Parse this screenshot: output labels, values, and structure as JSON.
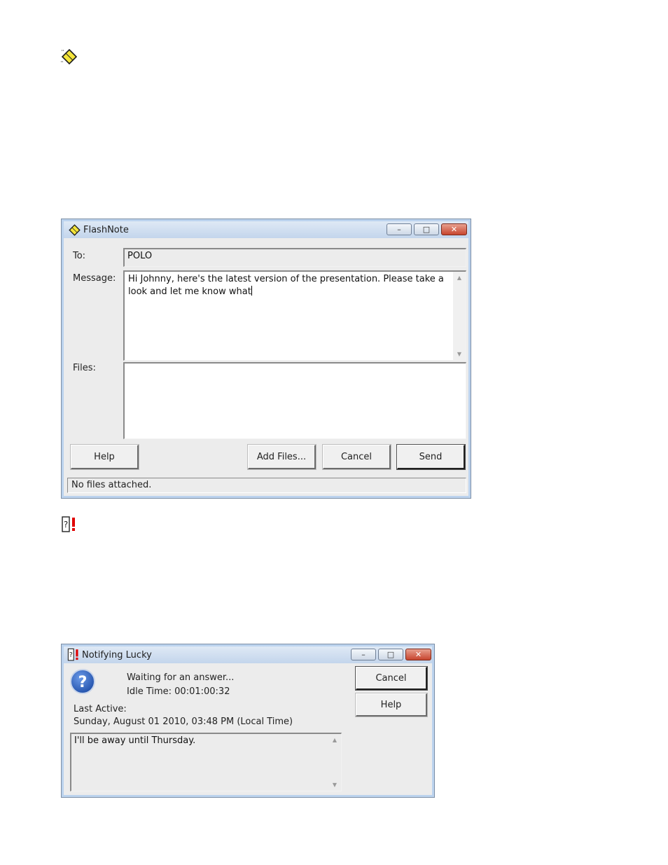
{
  "flashnote_window": {
    "title": "FlashNote",
    "minimize": "–",
    "maximize": "□",
    "close": "✕",
    "to_label": "To:",
    "to_value": "POLO",
    "message_label": "Message:",
    "message_value": "Hi Johnny, here's the latest version of the presentation. Please take a look and let me know what",
    "files_label": "Files:",
    "buttons": {
      "help": "Help",
      "add_files": "Add Files...",
      "cancel": "Cancel",
      "send": "Send"
    },
    "status": "No files attached."
  },
  "notify_window": {
    "title": "Notifying Lucky",
    "minimize": "–",
    "maximize": "□",
    "close": "✕",
    "waiting": "Waiting for an answer...",
    "idle": "Idle Time: 00:01:00:32",
    "last_active_label": "Last Active:",
    "last_active_value": "Sunday, August 01 2010, 03:48 PM (Local Time)",
    "away_message": "I'll be away until Thursday.",
    "buttons": {
      "cancel": "Cancel",
      "help": "Help"
    },
    "question_glyph": "?"
  },
  "icons": {
    "flashnote": "flashnote-diamond-icon",
    "notify": "notify-exclamation-icon"
  },
  "colors": {
    "titlebar": "#c3d5ec",
    "close": "#c7452e",
    "question": "#1f4ea8",
    "exclamation": "#e00000"
  }
}
